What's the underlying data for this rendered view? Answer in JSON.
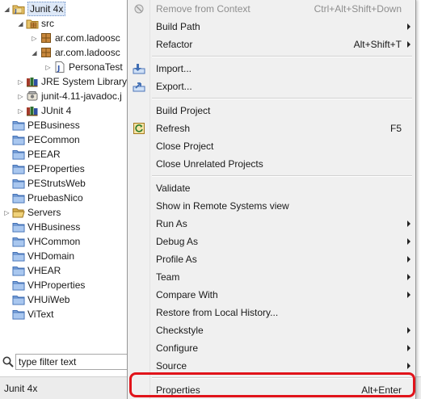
{
  "explorer": {
    "items": [
      {
        "label": "Junit 4x",
        "icon": "project-icon",
        "twisty": "down",
        "indent": 0,
        "selected": true
      },
      {
        "label": "src",
        "icon": "package-folder-icon",
        "twisty": "down",
        "indent": 1
      },
      {
        "label": "ar.com.ladoosc",
        "icon": "package-icon",
        "twisty": "right",
        "indent": 2
      },
      {
        "label": "ar.com.ladoosc",
        "icon": "package-icon",
        "twisty": "down",
        "indent": 2
      },
      {
        "label": "PersonaTest",
        "icon": "java-file-icon",
        "twisty": "right",
        "indent": 3
      },
      {
        "label": "JRE System Library",
        "icon": "library-icon",
        "twisty": "right",
        "indent": 1
      },
      {
        "label": "junit-4.11-javadoc.j",
        "icon": "jar-icon",
        "twisty": "right",
        "indent": 1
      },
      {
        "label": "JUnit 4",
        "icon": "library-icon",
        "twisty": "right",
        "indent": 1
      },
      {
        "label": "PEBusiness",
        "icon": "folder-icon",
        "twisty": "",
        "indent": 0
      },
      {
        "label": "PECommon",
        "icon": "folder-icon",
        "twisty": "",
        "indent": 0
      },
      {
        "label": "PEEAR",
        "icon": "folder-icon",
        "twisty": "",
        "indent": 0
      },
      {
        "label": "PEProperties",
        "icon": "folder-icon",
        "twisty": "",
        "indent": 0
      },
      {
        "label": "PEStrutsWeb",
        "icon": "folder-icon",
        "twisty": "",
        "indent": 0
      },
      {
        "label": "PruebasNico",
        "icon": "folder-icon",
        "twisty": "",
        "indent": 0
      },
      {
        "label": "Servers",
        "icon": "open-folder-icon",
        "twisty": "right",
        "indent": 0
      },
      {
        "label": "VHBusiness",
        "icon": "folder-icon",
        "twisty": "",
        "indent": 0
      },
      {
        "label": "VHCommon",
        "icon": "folder-icon",
        "twisty": "",
        "indent": 0
      },
      {
        "label": "VHDomain",
        "icon": "folder-icon",
        "twisty": "",
        "indent": 0
      },
      {
        "label": "VHEAR",
        "icon": "folder-icon",
        "twisty": "",
        "indent": 0
      },
      {
        "label": "VHProperties",
        "icon": "folder-icon",
        "twisty": "",
        "indent": 0
      },
      {
        "label": "VHUiWeb",
        "icon": "folder-icon",
        "twisty": "",
        "indent": 0
      },
      {
        "label": "ViText",
        "icon": "folder-icon",
        "twisty": "",
        "indent": 0
      }
    ],
    "filter": {
      "value": "type filter text",
      "placeholder": "type filter text"
    }
  },
  "status": {
    "text": "Junit 4x"
  },
  "menu": {
    "entries": [
      {
        "label": "Remove from Context",
        "shortcut": "Ctrl+Alt+Shift+Down",
        "icon": "remove-context-icon",
        "disabled": true
      },
      {
        "label": "Build Path",
        "submenu": true
      },
      {
        "label": "Refactor",
        "shortcut": "Alt+Shift+T",
        "submenu": true
      },
      {
        "separator": true
      },
      {
        "label": "Import...",
        "icon": "import-icon"
      },
      {
        "label": "Export...",
        "icon": "export-icon"
      },
      {
        "separator": true
      },
      {
        "label": "Build Project"
      },
      {
        "label": "Refresh",
        "shortcut": "F5",
        "icon": "refresh-icon"
      },
      {
        "label": "Close Project"
      },
      {
        "label": "Close Unrelated Projects"
      },
      {
        "separator": true
      },
      {
        "label": "Validate"
      },
      {
        "label": "Show in Remote Systems view"
      },
      {
        "label": "Run As",
        "submenu": true
      },
      {
        "label": "Debug As",
        "submenu": true
      },
      {
        "label": "Profile As",
        "submenu": true
      },
      {
        "label": "Team",
        "submenu": true
      },
      {
        "label": "Compare With",
        "submenu": true
      },
      {
        "label": "Restore from Local History..."
      },
      {
        "label": "Checkstyle",
        "submenu": true
      },
      {
        "label": "Configure",
        "submenu": true
      },
      {
        "label": "Source",
        "submenu": true
      },
      {
        "separator": true
      },
      {
        "label": "Properties",
        "shortcut": "Alt+Enter",
        "highlighted": true
      }
    ]
  },
  "colors": {
    "highlight": "#e1141b",
    "selection": "#dde8f7",
    "menu_bg": "#f0f0f0"
  }
}
